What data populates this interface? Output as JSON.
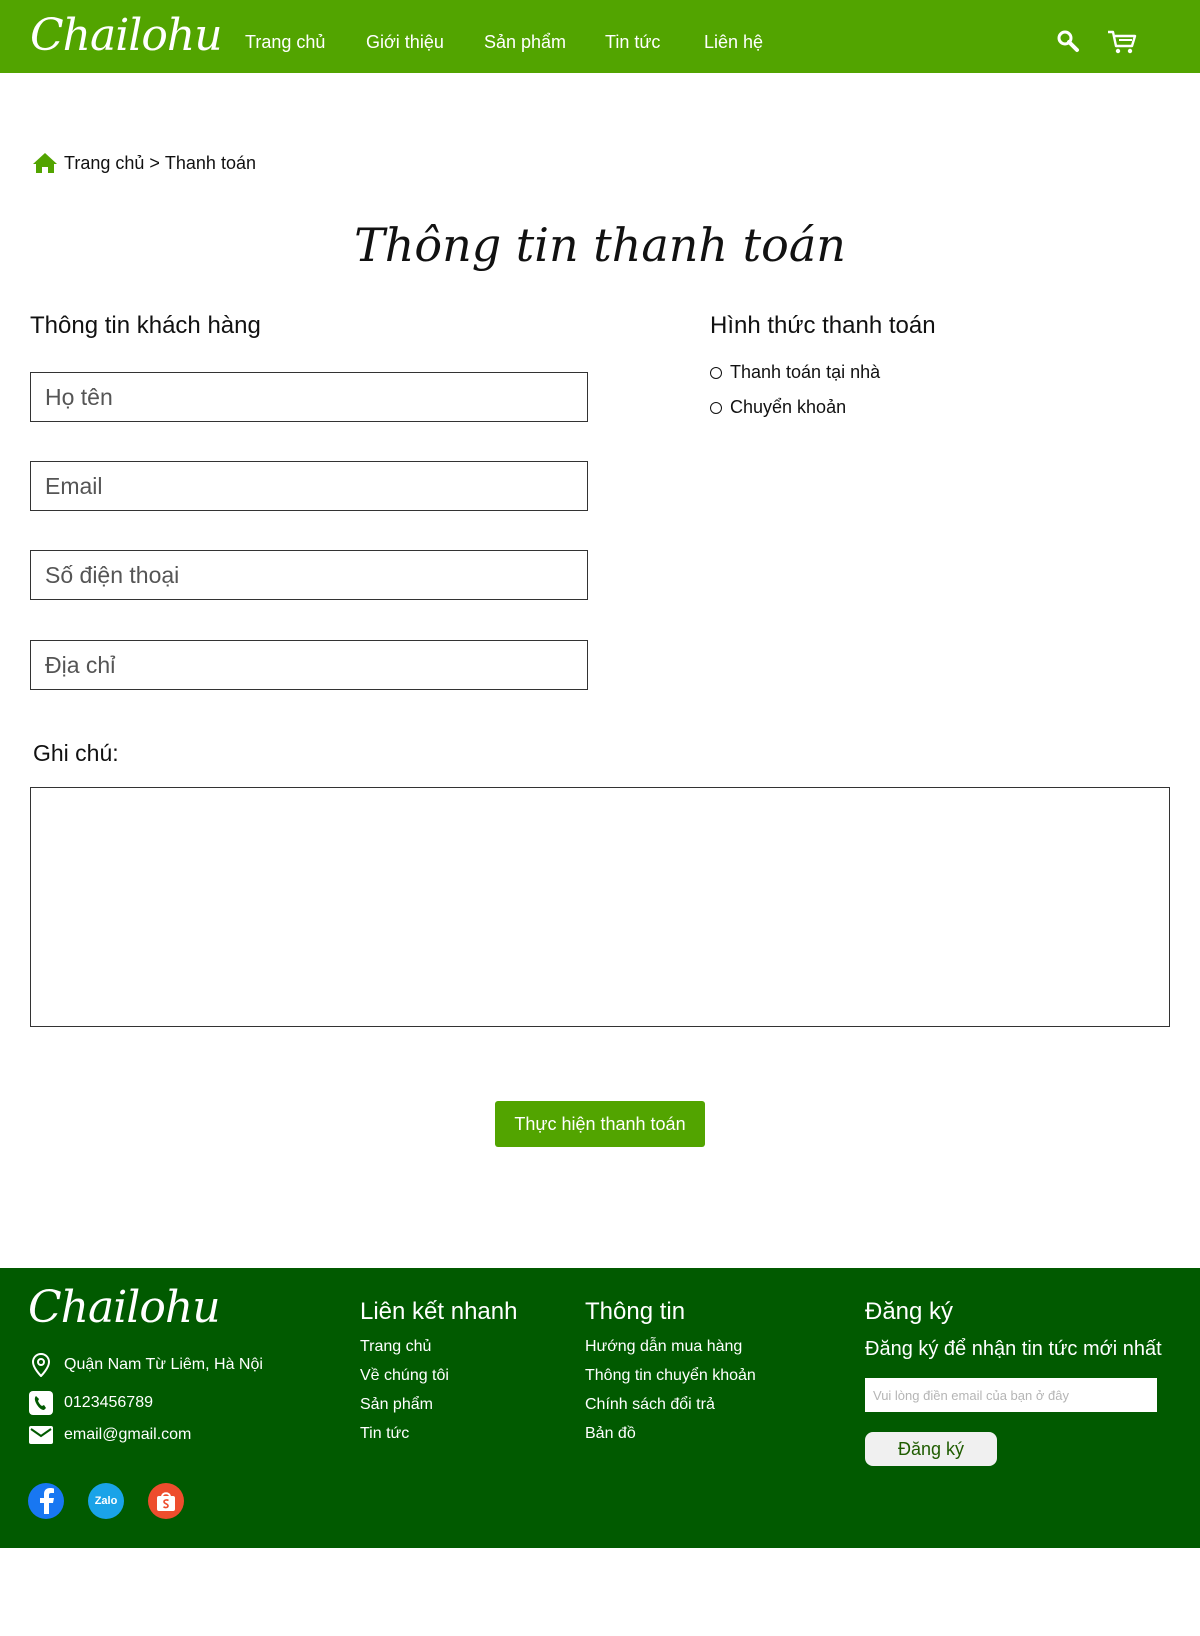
{
  "header": {
    "logo": "Chailohu",
    "nav": [
      "Trang chủ",
      "Giới thiệu",
      "Sản phẩm",
      "Tin tức",
      "Liên hệ"
    ],
    "icons": [
      "search-icon",
      "cart-icon"
    ]
  },
  "breadcrumb": {
    "home": "Trang chủ",
    "separator": ">",
    "current": "Thanh toán"
  },
  "page_title": "Thông tin thanh toán",
  "customer": {
    "title": "Thông tin khách hàng",
    "fields": [
      {
        "placeholder": "Họ tên",
        "value": ""
      },
      {
        "placeholder": "Email",
        "value": ""
      },
      {
        "placeholder": "Số điện thoại",
        "value": ""
      },
      {
        "placeholder": "Địa chỉ",
        "value": ""
      }
    ]
  },
  "payment": {
    "title": "Hình thức thanh toán",
    "options": [
      "Thanh toán tại nhà",
      "Chuyển khoản"
    ]
  },
  "note": {
    "label": "Ghi chú:"
  },
  "submit_label": "Thực hiện thanh toán",
  "footer": {
    "logo": "Chailohu",
    "address": "Quận Nam Từ Liêm, Hà Nội",
    "phone": "0123456789",
    "email": "email@gmail.com",
    "quick_links": {
      "title": "Liên kết nhanh",
      "items": [
        "Trang chủ",
        "Về chúng tôi",
        "Sản phẩm",
        "Tin tức"
      ]
    },
    "info": {
      "title": "Thông tin",
      "items": [
        "Hướng dẫn mua hàng",
        "Thông tin chuyển khoản",
        "Chính sách đổi trả",
        "Bản đồ"
      ]
    },
    "signup": {
      "title": "Đăng ký",
      "subtitle": "Đăng ký để nhận tin tức mới nhất",
      "placeholder": "Vui lòng điền email của bạn ở đây",
      "button": "Đăng ký"
    },
    "social": [
      "facebook-icon",
      "zalo-icon",
      "shopee-icon"
    ],
    "zalo_text": "Zalo"
  },
  "colors": {
    "brand_green": "#52a400",
    "footer_green": "#015a00"
  }
}
